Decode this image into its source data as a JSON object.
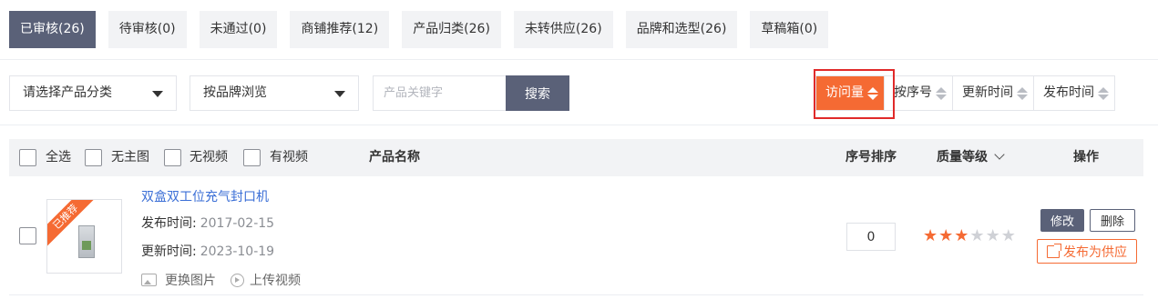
{
  "tabs": [
    {
      "label": "已审核(26)",
      "active": true
    },
    {
      "label": "待审核(0)",
      "active": false
    },
    {
      "label": "未通过(0)",
      "active": false
    },
    {
      "label": "商铺推荐(12)",
      "active": false
    },
    {
      "label": "产品归类(26)",
      "active": false
    },
    {
      "label": "未转供应(26)",
      "active": false
    },
    {
      "label": "品牌和选型(26)",
      "active": false
    },
    {
      "label": "草稿箱(0)",
      "active": false
    }
  ],
  "filters": {
    "category_select": "请选择产品分类",
    "brand_select": "按品牌浏览",
    "keyword_placeholder": "产品关键字",
    "search_label": "搜索"
  },
  "sort": {
    "visits": "访问量",
    "serial": "按序号",
    "updated": "更新时间",
    "published": "发布时间",
    "active": "visits"
  },
  "table_header": {
    "select_all": "全选",
    "no_main_image": "无主图",
    "no_video": "无视频",
    "has_video": "有视频",
    "product_name": "产品名称",
    "serial_sort": "序号排序",
    "quality_level": "质量等级",
    "actions": "操作"
  },
  "products": [
    {
      "name": "双盒双工位充气封口机",
      "ribbon": "已推荐",
      "publish_label": "发布时间:",
      "publish_date": "2017-02-15",
      "update_label": "更新时间:",
      "update_date": "2023-10-19",
      "change_image": "更换图片",
      "upload_video": "上传视频",
      "serial": "0",
      "quality_stars": 3,
      "quality_max": 5,
      "edit_label": "修改",
      "delete_label": "删除",
      "publish_supply_label": "发布为供应"
    }
  ],
  "colors": {
    "accent": "#f56a33",
    "primary_dark": "#5a6178",
    "link": "#3a6ed6",
    "highlight_border": "#e02a2a"
  }
}
